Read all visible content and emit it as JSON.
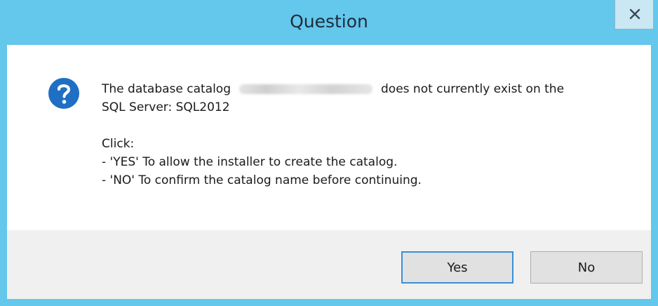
{
  "window": {
    "title": "Question",
    "close_label": "×"
  },
  "message": {
    "line1_prefix": "The database catalog",
    "line1_suffix": "does not currently exist on the",
    "line2": "SQL Server: SQL2012",
    "click_label": "Click:",
    "yes_instruction": "- 'YES' To allow the installer to create the catalog.",
    "no_instruction": "- 'NO' To confirm the catalog name before continuing."
  },
  "buttons": {
    "yes_label": "Yes",
    "no_label": "No"
  },
  "colors": {
    "titlebar": "#64c7ec",
    "icon_blue": "#1f6fc4",
    "default_button_border": "#3a8fd6"
  },
  "icons": {
    "dialog_icon": "question-icon",
    "close_icon": "close-icon"
  }
}
